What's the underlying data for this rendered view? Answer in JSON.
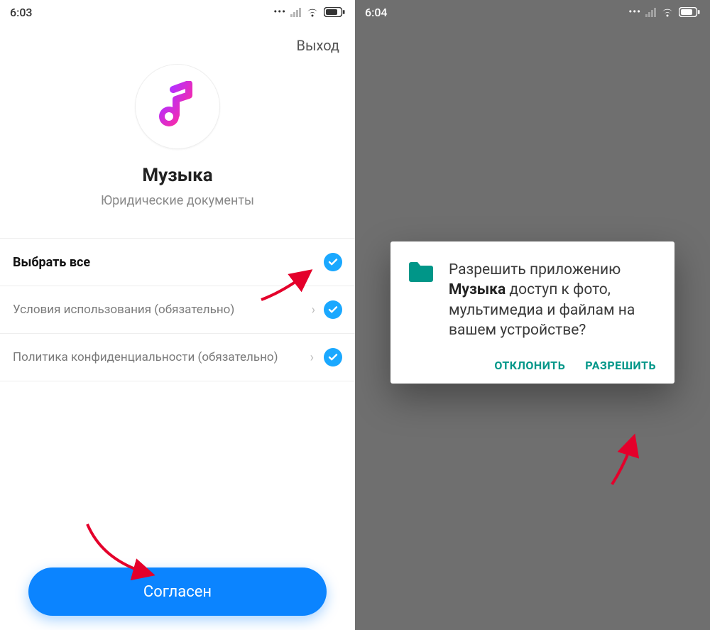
{
  "left": {
    "status": {
      "time": "6:03"
    },
    "exit": "Выход",
    "app_title": "Музыка",
    "app_subtitle": "Юридические документы",
    "rows": {
      "select_all": "Выбрать все",
      "terms": "Условия использования (обязательно)",
      "privacy": "Политика конфиденциальности (обязательно)"
    },
    "agree": "Согласен"
  },
  "right": {
    "status": {
      "time": "6:04"
    },
    "dialog": {
      "prefix": "Разрешить приложению ",
      "app_name": "Музыка",
      "suffix": " доступ к фото, мультимедиа и файлам на вашем устройстве?",
      "deny": "ОТКЛОНИТЬ",
      "allow": "РАЗРЕШИТЬ"
    }
  },
  "colors": {
    "accent_blue": "#0b84ff",
    "check_blue": "#1aa8ff",
    "teal": "#009688",
    "annotation_red": "#e4002b"
  }
}
